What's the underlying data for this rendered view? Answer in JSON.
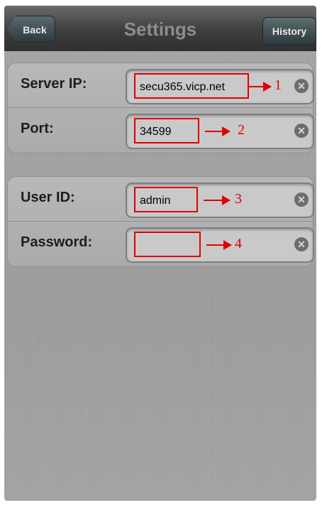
{
  "nav": {
    "title": "Settings",
    "back_label": "Back",
    "history_label": "History"
  },
  "groups": [
    {
      "rows": [
        {
          "label": "Server IP:",
          "value": "secu365.vicp.net",
          "annotation": "1"
        },
        {
          "label": "Port:",
          "value": "34599",
          "annotation": "2"
        }
      ]
    },
    {
      "rows": [
        {
          "label": "User ID:",
          "value": "admin",
          "annotation": "3"
        },
        {
          "label": "Password:",
          "value": "",
          "annotation": "4"
        }
      ]
    }
  ],
  "icons": {
    "clear": "clear-icon",
    "back": "back-chevron-icon"
  },
  "colors": {
    "annotation_red": "#e00000",
    "navbar": "#3e3e3e",
    "background": "#a6a6a6"
  }
}
